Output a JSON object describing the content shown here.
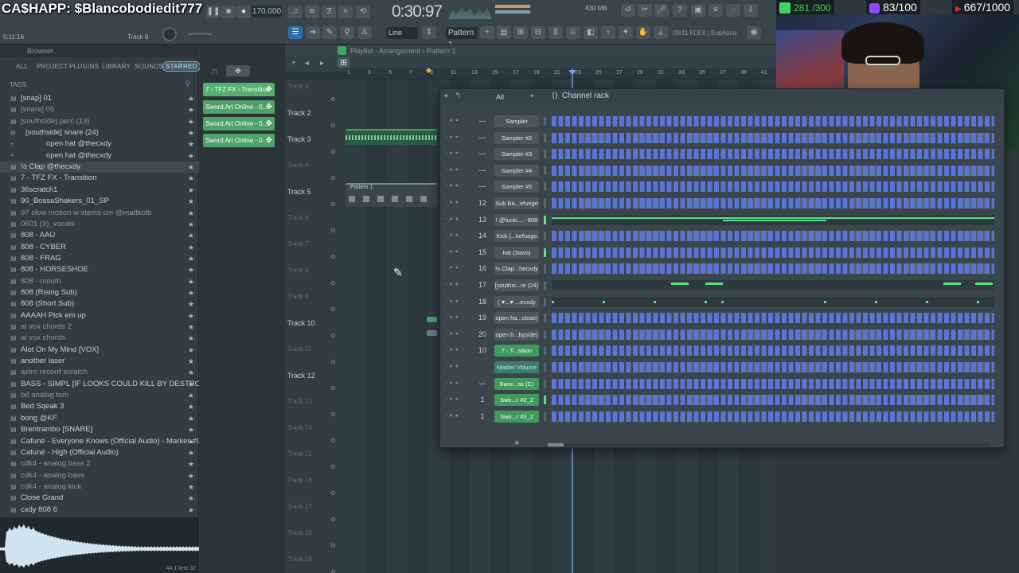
{
  "overlay": {
    "cashapp": "CA$HAPP: $Blancobodiedit777",
    "goal_green": "281 /300",
    "goal_purple": "83/100",
    "goal_red": "667/1000"
  },
  "toolbar": {
    "tempo": "170.000",
    "time": "0:30:97",
    "cpu": "430 MB",
    "song_pos": "5:11:16",
    "track_label": "Track 8",
    "snap_label": "Line",
    "pattern_label": "Pattern 1",
    "hint_text": "09/11  FLEX | Euphona",
    "accent": "#2e6ea8"
  },
  "browser": {
    "title": "Browser",
    "tabs": [
      "ALL",
      "PROJECT",
      "PLUGINS",
      "LIBRARY",
      "SOUNDS",
      "STARRED"
    ],
    "tags_label": "TAGS",
    "items": [
      {
        "label": "[snap] 01",
        "dim": false
      },
      {
        "label": "[snare] 05",
        "dim": true
      },
      {
        "label": "[southside] perc (13)",
        "dim": true
      },
      {
        "label": "[southside] snare (24)",
        "dim": false
      },
      {
        "label": "open hat @thecxdy",
        "dim": false
      },
      {
        "label": "open hat @thecxdy",
        "dim": false
      },
      {
        "label": "½ Clap @thecxdy",
        "dim": false
      },
      {
        "label": "7 - TFZ FX - Transition",
        "dim": false
      },
      {
        "label": "36scratch1",
        "dim": false
      },
      {
        "label": "90_BossaShakers_01_SP",
        "dim": false
      },
      {
        "label": "97 slow motion w stems cm @mattkolb",
        "dim": true
      },
      {
        "label": "0601 (3)_vocals",
        "dim": true
      },
      {
        "label": "808 - AAU",
        "dim": false
      },
      {
        "label": "808 - CYBER",
        "dim": false
      },
      {
        "label": "808 - FRAG",
        "dim": false
      },
      {
        "label": "808 - HORSESHOE",
        "dim": false
      },
      {
        "label": "808 - mouth",
        "dim": true
      },
      {
        "label": "808 (Rising Sub)",
        "dim": false
      },
      {
        "label": "808 (Short Sub)",
        "dim": false
      },
      {
        "label": "AAAAH Pick em up",
        "dim": false
      },
      {
        "label": "al vox chords 2",
        "dim": true
      },
      {
        "label": "al vox chords",
        "dim": true
      },
      {
        "label": "Alot On My Mind [VOX]",
        "dim": false
      },
      {
        "label": "another laser",
        "dim": false
      },
      {
        "label": "astro record scratch",
        "dim": true
      },
      {
        "label": "BASS - SIMPL [IF LOOKS COULD KILL BY DESTROY LONELY]",
        "dim": false
      },
      {
        "label": "bd analog tom",
        "dim": true
      },
      {
        "label": "Bed Sqeak 3",
        "dim": false
      },
      {
        "label": "bong @KF",
        "dim": false
      },
      {
        "label": "Brentrambo [SNARE]",
        "dim": false
      },
      {
        "label": "Cafuné - Everyone Knows (Official Audio) - Marker #9_3_drums",
        "dim": false
      },
      {
        "label": "Cafuné - High (Official Audio)",
        "dim": false
      },
      {
        "label": "cdk4 - analog bass 2",
        "dim": true
      },
      {
        "label": "cdk4 - analog bass",
        "dim": true
      },
      {
        "label": "cdk4 - analog kick",
        "dim": true
      },
      {
        "label": "Close Grand",
        "dim": false
      },
      {
        "label": "cxdy 808 6",
        "dim": false
      }
    ],
    "wave_info": "44.1 kHz 32"
  },
  "picker": {
    "items": [
      "7 - TFZ FX - Transition",
      "Sword Art Online - 0...",
      "Sword Art Online - 0...",
      "Sword Art Online - 0..."
    ]
  },
  "playlist": {
    "title": "Playlist - Arrangement › Pattern 1",
    "ruler": [
      "1",
      "3",
      "5",
      "7",
      "9",
      "11",
      "13",
      "15",
      "17",
      "19",
      "21",
      "23",
      "25",
      "27",
      "29",
      "31",
      "33",
      "35",
      "37",
      "39",
      "41"
    ],
    "tracks": [
      {
        "label": "Track 1",
        "dim": true
      },
      {
        "label": "Track 2",
        "dim": false
      },
      {
        "label": "Track 3",
        "dim": false
      },
      {
        "label": "Track 4",
        "dim": true
      },
      {
        "label": "Track 5",
        "dim": false
      },
      {
        "label": "Track 6",
        "dim": true
      },
      {
        "label": "Track 7",
        "dim": true
      },
      {
        "label": "Track 8",
        "dim": true
      },
      {
        "label": "Track 9",
        "dim": true
      },
      {
        "label": "Track 10",
        "dim": false
      },
      {
        "label": "Track 11",
        "dim": true
      },
      {
        "label": "Track 12",
        "dim": false
      },
      {
        "label": "Track 13",
        "dim": true
      },
      {
        "label": "Track 14",
        "dim": true
      },
      {
        "label": "Track 15",
        "dim": true
      },
      {
        "label": "Track 16",
        "dim": true
      },
      {
        "label": "Track 17",
        "dim": true
      },
      {
        "label": "Track 18",
        "dim": true
      },
      {
        "label": "Track 19",
        "dim": true
      }
    ],
    "clip_pattern_label": "Pattern 1"
  },
  "rack": {
    "title": "Channel rack",
    "filter": "All",
    "channels": [
      {
        "num": "---",
        "name": "Sampler",
        "style": "grey",
        "type": "steps",
        "led": false
      },
      {
        "num": "---",
        "name": "Sampler #2",
        "style": "grey",
        "type": "steps",
        "led": false
      },
      {
        "num": "---",
        "name": "Sampler #3",
        "style": "grey",
        "type": "steps",
        "led": false
      },
      {
        "num": "---",
        "name": "Sampler #4",
        "style": "grey",
        "type": "steps",
        "led": false
      },
      {
        "num": "---",
        "name": "Sampler #5",
        "style": "grey",
        "type": "steps",
        "led": false
      },
      {
        "num": "12",
        "name": "Sub Ba...efuego",
        "style": "grey",
        "type": "steps",
        "led": false
      },
      {
        "num": "13",
        "name": "! @fucki... - 808",
        "style": "grey",
        "type": "roll",
        "led": true
      },
      {
        "num": "14",
        "name": "Kick [...kefuego",
        "style": "grey",
        "type": "steps",
        "led": false
      },
      {
        "num": "15",
        "name": "hat (3aws)",
        "style": "grey",
        "type": "steps",
        "led": true
      },
      {
        "num": "16",
        "name": "½ Clap...hecxdy",
        "style": "grey",
        "type": "steps",
        "led": false
      },
      {
        "num": "17",
        "name": "[southsi...re (24)",
        "style": "grey",
        "type": "roll",
        "led": false
      },
      {
        "num": "18",
        "name": "( ♥...♥ ...ecxdy",
        "style": "grey",
        "type": "roll",
        "led": false
      },
      {
        "num": "19",
        "name": "open ha...close)",
        "style": "grey",
        "type": "steps",
        "led": false
      },
      {
        "num": "20",
        "name": "open h...byside)",
        "style": "grey",
        "type": "steps",
        "led": false
      },
      {
        "num": "10",
        "name": "7 - T...sition",
        "style": "green",
        "type": "steps",
        "led": false
      },
      {
        "num": "",
        "name": "Master Volume",
        "style": "teal",
        "type": "steps",
        "led": false
      },
      {
        "num": "---",
        "name": "Swor...ss (C)",
        "style": "green",
        "type": "steps",
        "led": false
      },
      {
        "num": "1",
        "name": "Swo...r #2_2",
        "style": "green",
        "type": "steps",
        "led": true
      },
      {
        "num": "1",
        "name": "Swo...r #3_2",
        "style": "green",
        "type": "steps",
        "led": false
      }
    ]
  }
}
